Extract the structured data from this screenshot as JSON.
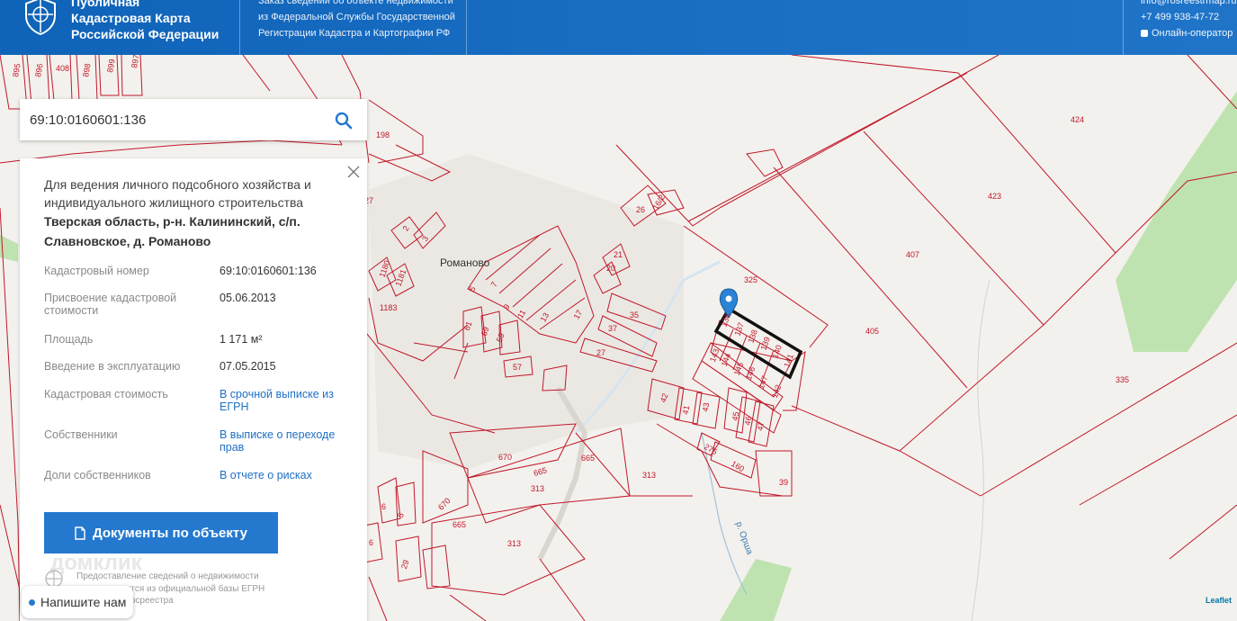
{
  "header": {
    "brand_line1": "Публичная",
    "brand_line2": "Кадастровая Карта",
    "brand_line3": "Российской Федерации",
    "order_line1": "Заказ сведений об объекте недвижимости",
    "order_line2": "из Федеральной Службы Государственной",
    "order_line3": "Регистрации Кадастра и Картографии РФ",
    "email": "info@rosreestrmap.ru",
    "phone": "+7 499 938-47-72",
    "online_operator": "Онлайн-оператор"
  },
  "search": {
    "value": "69:10:0160601:136",
    "icon": "search-icon"
  },
  "panel": {
    "purpose": "Для ведения личного подсобного хозяйства и индивидуального жилищного строительства",
    "address": "Тверская область, р-н. Калининский, с/п. Славновское, д. Романово",
    "rows": [
      {
        "key": "Кадастровый номер",
        "value": "69:10:0160601:136"
      },
      {
        "key": "Присвоение кадастровой стоимости",
        "value": "05.06.2013"
      },
      {
        "key": "Площадь",
        "value": "1 171 м²"
      },
      {
        "key": "Введение в эксплуатацию",
        "value": "07.05.2015"
      },
      {
        "key": "Кадастровая стоимость",
        "value": "В срочной выписке из ЕГРН"
      },
      {
        "key": "Собственники",
        "value": "В выписке о переходе прав"
      },
      {
        "key": "Доли собственников",
        "value": "В отчете о рисках"
      }
    ],
    "docs_button": "Документы по объекту",
    "disclaimer": "Предоставление сведений о недвижимости осуществляется из официальной базы ЕГРН через ЭЦП Росреестра",
    "watermark": "домклик"
  },
  "chat": {
    "label": "Напишите нам"
  },
  "map": {
    "village_label": "Романово",
    "river_label": "р. Орша",
    "attribution": "Leaflet",
    "parcel_numbers": [
      "896",
      "895",
      "408",
      "898",
      "899",
      "897",
      "198",
      "27",
      "2",
      "3",
      "1180",
      "1181",
      "1183",
      "26",
      "16/2",
      "21",
      "20",
      "17",
      "13",
      "11",
      "9",
      "7",
      "5",
      "61",
      "69",
      "59",
      "57",
      "35",
      "37",
      "27",
      "325",
      "136",
      "137",
      "138",
      "139",
      "140",
      "141",
      "143",
      "144",
      "145",
      "146",
      "147",
      "142",
      "42",
      "41",
      "43",
      "45",
      "46",
      "47",
      "275",
      "160",
      "39",
      "670",
      "665",
      "665",
      "313",
      "313",
      "313",
      "670",
      "665",
      "6",
      "5",
      "6",
      "29",
      "424",
      "423",
      "407",
      "405",
      "335"
    ]
  },
  "colors": {
    "header_blue": "#1a6fc4",
    "parcel_red": "#c0182a",
    "button_blue": "#2479cf",
    "link_blue": "#1f6fc5"
  }
}
